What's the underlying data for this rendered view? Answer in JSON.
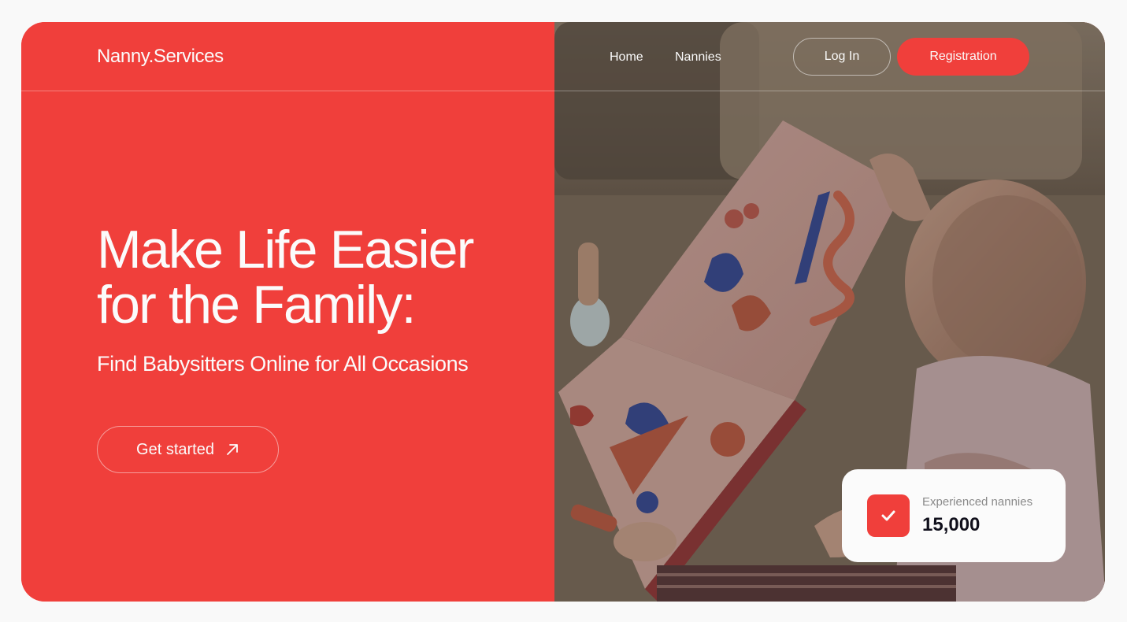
{
  "brand": {
    "logo": "Nanny.Services"
  },
  "nav": {
    "links": [
      {
        "label": "Home"
      },
      {
        "label": "Nannies"
      }
    ],
    "login_label": "Log In",
    "register_label": "Registration"
  },
  "hero": {
    "title_line1": "Make Life Easier",
    "title_line2": "for the Family:",
    "subtitle": "Find Babysitters Online for All Occasions",
    "cta_label": "Get started"
  },
  "stat": {
    "label": "Experienced nannies",
    "value": "15,000"
  },
  "colors": {
    "accent": "#f03f3b",
    "text_light": "#fbfbfb",
    "text_dark": "#11101c",
    "background": "#f9f9f9"
  },
  "icons": {
    "cta": "arrow-up-right-icon",
    "stat": "check-icon"
  }
}
